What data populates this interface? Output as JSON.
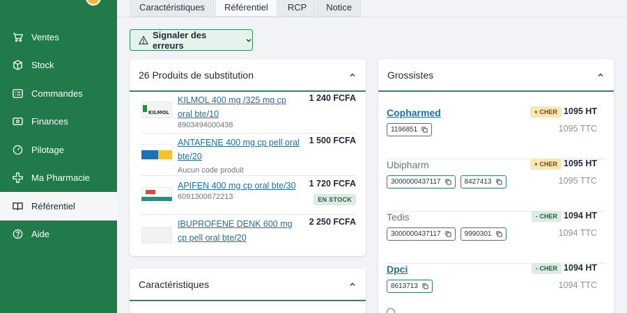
{
  "nav": {
    "items": [
      {
        "label": "Ventes",
        "icon": "cart-icon"
      },
      {
        "label": "Stock",
        "icon": "box-icon"
      },
      {
        "label": "Commandes",
        "icon": "list-icon"
      },
      {
        "label": "Finances",
        "icon": "cash-icon"
      },
      {
        "label": "Pilotage",
        "icon": "gauge-icon"
      },
      {
        "label": "Ma Pharmacie",
        "icon": "cross-icon"
      },
      {
        "label": "Référentiel",
        "icon": "book-icon",
        "active": true
      },
      {
        "label": "Aide",
        "icon": "help-icon"
      }
    ]
  },
  "tabs": [
    "Caractéristiques",
    "Référentiel",
    "RCP",
    "Notice"
  ],
  "active_tab": "Référentiel",
  "report_button": "Signaler des erreurs",
  "substitution": {
    "title": "26 Produits de substitution",
    "products": [
      {
        "name": "KILMOL 400 mg /325 mg cp oral bte/10",
        "code": "8903494000438",
        "price": "1 240 FCFA",
        "stock": ""
      },
      {
        "name": "ANTAFENE 400 mg cp pell oral bte/20",
        "code": "Aucun code produit",
        "price": "1 500 FCFA",
        "stock": ""
      },
      {
        "name": "APIFEN 400 mg cp oral bte/30",
        "code": "6091300672213",
        "price": "1 720 FCFA",
        "stock": "EN STOCK"
      },
      {
        "name": "IBUPROFENE DENK 600 mg cp pell oral bte/20",
        "code": "",
        "price": "2 250 FCFA",
        "stock": ""
      }
    ]
  },
  "characteristics": {
    "title": "Caractéristiques"
  },
  "wholesalers": {
    "title": "Grossistes",
    "rows": [
      {
        "name": "Copharmed",
        "link": true,
        "tag": "+ CHER",
        "tag_kind": "up",
        "ht": "1095 HT",
        "ttc": "1095 TTC",
        "codes": [
          "1196851"
        ]
      },
      {
        "name": "Ubipharm",
        "link": false,
        "tag": "+ CHER",
        "tag_kind": "up",
        "ht": "1095 HT",
        "ttc": "1095 TTC",
        "codes": [
          "3000000437117",
          "8427413"
        ]
      },
      {
        "name": "Tedis",
        "link": false,
        "tag": "- CHER",
        "tag_kind": "down",
        "ht": "1094 HT",
        "ttc": "1094 TTC",
        "codes": [
          "3000000437117",
          "9990301"
        ]
      },
      {
        "name": "Dpci",
        "link": true,
        "tag": "- CHER",
        "tag_kind": "down",
        "ht": "1094 HT",
        "ttc": "1094 TTC",
        "codes": [
          "8613713"
        ]
      }
    ]
  },
  "colors": {
    "brand": "#217a49",
    "accent": "#2c8a59",
    "link": "#1d6fa5"
  }
}
